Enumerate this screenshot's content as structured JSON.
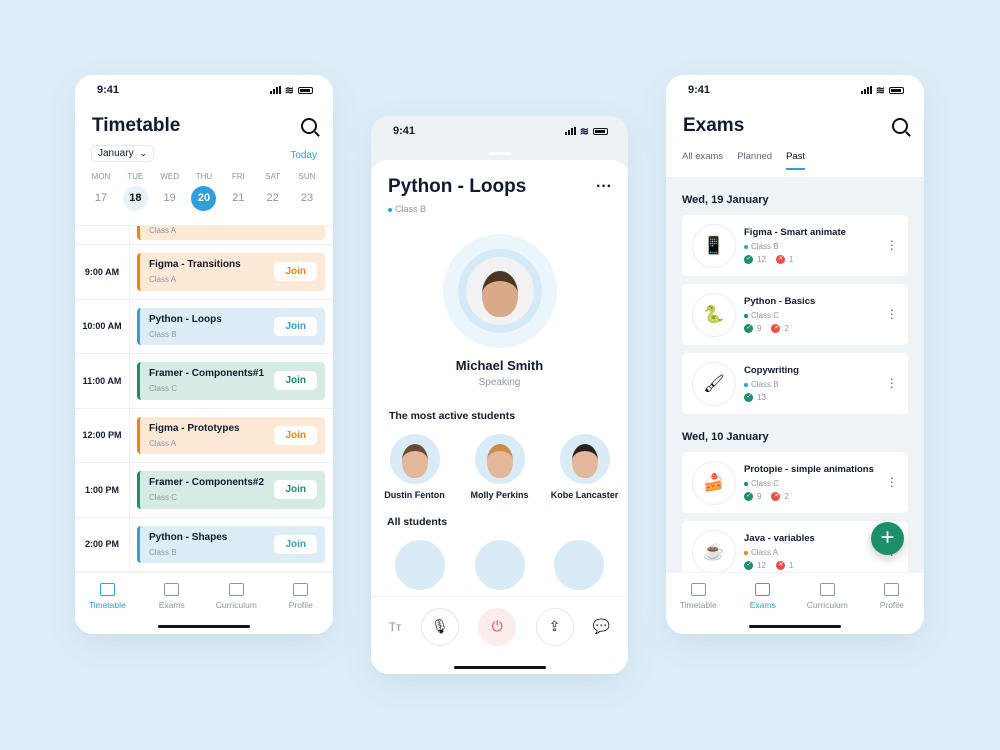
{
  "status_time": "9:41",
  "timetable": {
    "title": "Timetable",
    "month": "January",
    "today_label": "Today",
    "days": [
      {
        "d": "MON",
        "n": "17"
      },
      {
        "d": "TUE",
        "n": "18"
      },
      {
        "d": "WED",
        "n": "19"
      },
      {
        "d": "THU",
        "n": "20"
      },
      {
        "d": "FRI",
        "n": "21"
      },
      {
        "d": "SAT",
        "n": "22"
      },
      {
        "d": "SUN",
        "n": "23"
      }
    ],
    "selected_day": "20",
    "partial_class": "Class A",
    "rows": [
      {
        "time": "9:00 AM",
        "title": "Figma - Transitions",
        "class": "Class A",
        "color": "orange",
        "join": "Join"
      },
      {
        "time": "10:00 AM",
        "title": "Python - Loops",
        "class": "Class B",
        "color": "blue",
        "join": "Join"
      },
      {
        "time": "11:00 AM",
        "title": "Framer - Components#1",
        "class": "Class C",
        "color": "green",
        "join": "Join"
      },
      {
        "time": "12:00 PM",
        "title": "Figma - Prototypes",
        "class": "Class A",
        "color": "orange",
        "join": "Join"
      },
      {
        "time": "1:00 PM",
        "title": "Framer - Components#2",
        "class": "Class C",
        "color": "green",
        "join": "Join"
      },
      {
        "time": "2:00 PM",
        "title": "Python - Shapes",
        "class": "Class B",
        "color": "blue",
        "join": "Join"
      }
    ]
  },
  "colors": {
    "orange": [
      "#f5820d",
      "#fde9d5"
    ],
    "blue": [
      "#2fa0dc",
      "#dcedf8"
    ],
    "green": [
      "#1a8f6a",
      "#d6ebe3"
    ],
    "accent": "#2fa0dc",
    "fab": "#1a8f6a",
    "fail": "#ef4c3f"
  },
  "nav": [
    {
      "label": "Timetable",
      "icon": "calendar-icon"
    },
    {
      "label": "Exams",
      "icon": "pencil-icon"
    },
    {
      "label": "Curriculum",
      "icon": "book-icon"
    },
    {
      "label": "Profile",
      "icon": "user-icon"
    }
  ],
  "call": {
    "title": "Python - Loops",
    "class": "Class B",
    "speaker": "Michael Smith",
    "speaker_status": "Speaking",
    "active_heading": "The most active students",
    "active": [
      "Dustin Fenton",
      "Molly Perkins",
      "Kobe Lancaster"
    ],
    "all_heading": "All students",
    "text_btn": "Tт"
  },
  "exams": {
    "title": "Exams",
    "tabs": [
      "All exams",
      "Planned",
      "Past"
    ],
    "active_tab": "Past",
    "groups": [
      {
        "date": "Wed, 19 January",
        "items": [
          {
            "emoji": "📱",
            "title": "Figma - Smart animate",
            "class": "Class B",
            "dot": "blue",
            "pass": "12",
            "fail": "1"
          },
          {
            "emoji": "🐍",
            "title": "Python - Basics",
            "class": "Class C",
            "dot": "green",
            "pass": "9",
            "fail": "2"
          },
          {
            "emoji": "🖌",
            "title": "Copywriting",
            "class": "Class B",
            "dot": "blue",
            "pass": "13",
            "fail": null
          }
        ]
      },
      {
        "date": "Wed, 10 January",
        "items": [
          {
            "emoji": "🍰",
            "title": "Protopie - simple animations",
            "class": "Class C",
            "dot": "green",
            "pass": "9",
            "fail": "2"
          },
          {
            "emoji": "☕",
            "title": "Java - variables",
            "class": "Class A",
            "dot": "orange",
            "pass": "12",
            "fail": "1"
          }
        ]
      }
    ]
  }
}
